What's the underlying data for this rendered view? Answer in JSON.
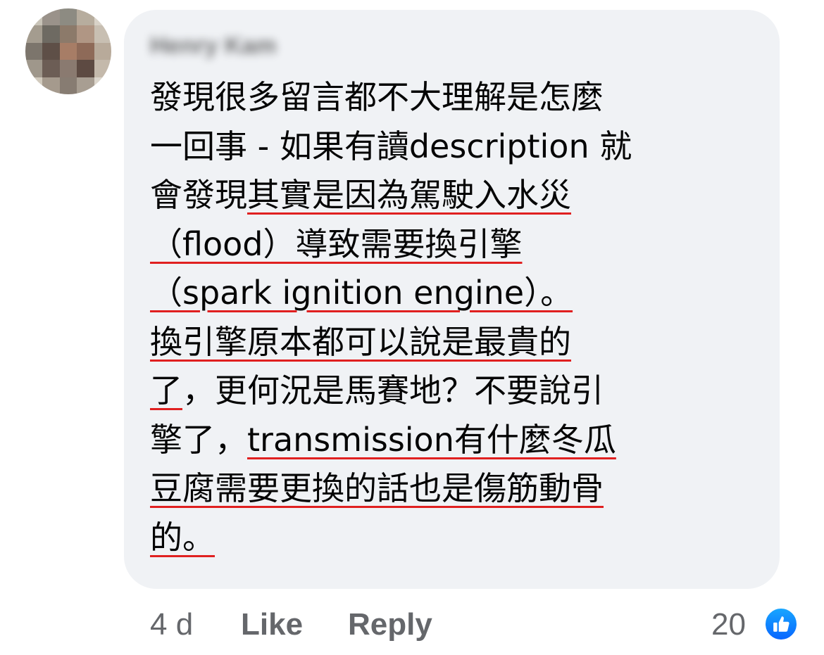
{
  "comment": {
    "author": "Henry Kam",
    "lines": [
      [
        {
          "text": "發現很多留言都不大理解是怎麼",
          "u": false
        }
      ],
      [
        {
          "text": "一回事 - 如果有讀description 就",
          "u": false
        }
      ],
      [
        {
          "text": "會發現",
          "u": false
        },
        {
          "text": "其實是因為駕駛入水災",
          "u": true
        }
      ],
      [
        {
          "text": "（flood）導致需要換引擎",
          "u": true
        }
      ],
      [
        {
          "text": "（spark ignition engine）。",
          "u": true
        }
      ],
      [
        {
          "text": "換引擎原本都可以說是最貴的",
          "u": true
        }
      ],
      [
        {
          "text": "了",
          "u": true
        },
        {
          "text": "，更何況是馬賽地？不要說引",
          "u": false
        }
      ],
      [
        {
          "text": "擎了，",
          "u": false
        },
        {
          "text": "transmission有什麼冬瓜",
          "u": true
        }
      ],
      [
        {
          "text": "豆腐需要更換的話也是傷筋動骨",
          "u": true
        }
      ],
      [
        {
          "text": "的。",
          "u": true
        }
      ]
    ]
  },
  "footer": {
    "time": "4 d",
    "like_label": "Like",
    "reply_label": "Reply",
    "reaction_count": "20",
    "reaction_icon": "thumbs-up-icon"
  },
  "colors": {
    "bubble": "#f0f2f5",
    "underline": "#e02020",
    "meta_text": "#65676b",
    "like_blue": "#1877f2"
  }
}
